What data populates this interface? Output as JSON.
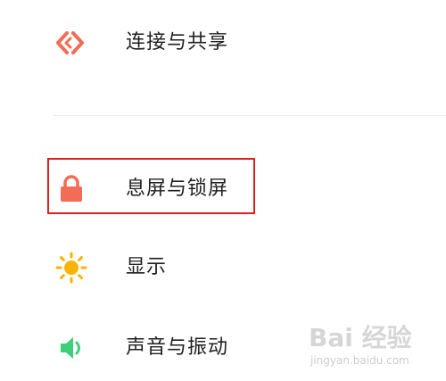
{
  "settings": {
    "items": [
      {
        "label": "连接与共享",
        "icon": "connection-share-icon",
        "color": "#f26c56"
      },
      {
        "label": "息屏与锁屏",
        "icon": "lock-icon",
        "color": "#f26c56",
        "highlighted": true
      },
      {
        "label": "显示",
        "icon": "sun-icon",
        "color": "#f8b400"
      },
      {
        "label": "声音与振动",
        "icon": "speaker-icon",
        "color": "#3fcf7a"
      }
    ]
  },
  "watermark": {
    "brand": "Bai 经验",
    "url": "jingyan.baidu.com"
  },
  "colors": {
    "highlight_border": "#e01f1f",
    "divider": "#ececec",
    "text": "#1f1f1f"
  }
}
